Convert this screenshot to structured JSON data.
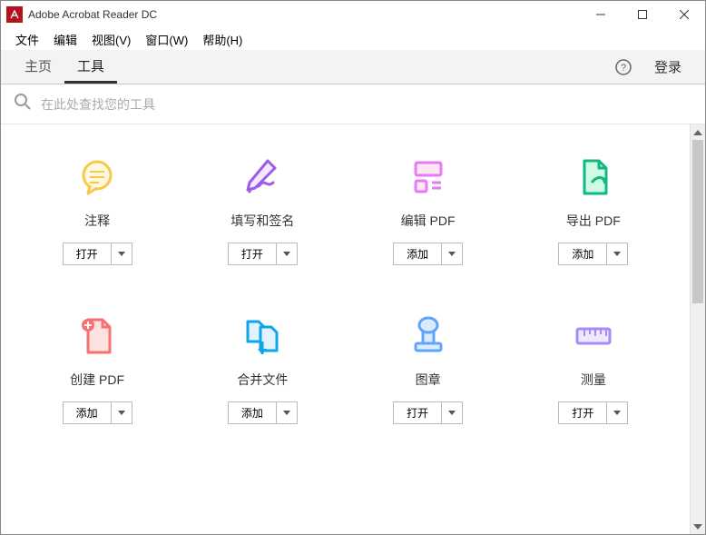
{
  "titlebar": {
    "title": "Adobe Acrobat Reader DC"
  },
  "menubar": {
    "items": [
      "文件",
      "编辑",
      "视图(V)",
      "窗口(W)",
      "帮助(H)"
    ]
  },
  "tabbar": {
    "tabs": [
      {
        "label": "主页",
        "active": false
      },
      {
        "label": "工具",
        "active": true
      }
    ],
    "login": "登录"
  },
  "search": {
    "placeholder": "在此处查找您的工具"
  },
  "tools": [
    {
      "label": "注释",
      "action": "打开",
      "icon": "comment",
      "color": "#F7C948"
    },
    {
      "label": "填写和签名",
      "action": "打开",
      "icon": "sign",
      "color": "#9B5DE5"
    },
    {
      "label": "编辑 PDF",
      "action": "添加",
      "icon": "edit",
      "color": "#E879F9"
    },
    {
      "label": "导出 PDF",
      "action": "添加",
      "icon": "export",
      "color": "#10B981"
    },
    {
      "label": "创建 PDF",
      "action": "添加",
      "icon": "create",
      "color": "#F87171"
    },
    {
      "label": "合并文件",
      "action": "添加",
      "icon": "combine",
      "color": "#0EA5E9"
    },
    {
      "label": "图章",
      "action": "打开",
      "icon": "stamp",
      "color": "#60A5FA"
    },
    {
      "label": "测量",
      "action": "打开",
      "icon": "measure",
      "color": "#A78BFA"
    }
  ]
}
